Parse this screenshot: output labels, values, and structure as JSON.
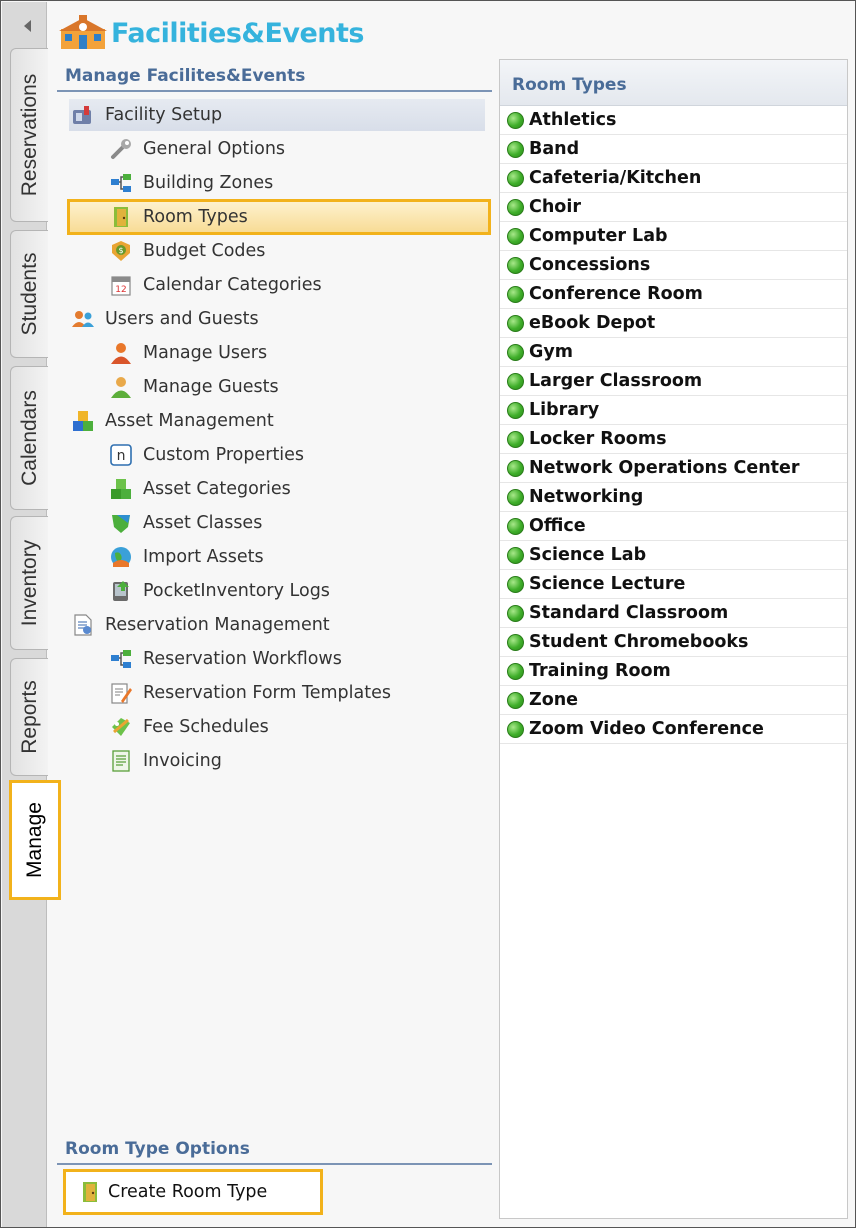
{
  "app": {
    "logo_text": "Facilities&Events"
  },
  "colors": {
    "accent_highlight": "#f2b21b",
    "header_text": "#4a6c98",
    "logo_blue": "#35b3dd",
    "status_green": "#3fae2a"
  },
  "tabs": [
    {
      "label": "Reservations",
      "active": false
    },
    {
      "label": "Students",
      "active": false
    },
    {
      "label": "Calendars",
      "active": false
    },
    {
      "label": "Inventory",
      "active": false
    },
    {
      "label": "Reports",
      "active": false
    },
    {
      "label": "Manage",
      "active": true
    }
  ],
  "manage": {
    "header": "Manage Facilites&Events",
    "items": [
      {
        "label": "Facility Setup",
        "icon": "facility-setup-icon",
        "level": "root",
        "selected": true
      },
      {
        "label": "General Options",
        "icon": "wrench-icon",
        "level": "child"
      },
      {
        "label": "Building Zones",
        "icon": "zones-icon",
        "level": "child"
      },
      {
        "label": "Room Types",
        "icon": "door-icon",
        "level": "child",
        "selected": true
      },
      {
        "label": "Budget Codes",
        "icon": "budget-icon",
        "level": "child"
      },
      {
        "label": "Calendar Categories",
        "icon": "calendar-icon",
        "level": "child"
      },
      {
        "label": "Users and Guests",
        "icon": "users-icon",
        "level": "root"
      },
      {
        "label": "Manage Users",
        "icon": "user-orange-icon",
        "level": "child"
      },
      {
        "label": "Manage Guests",
        "icon": "user-green-icon",
        "level": "child"
      },
      {
        "label": "Asset Management",
        "icon": "blocks-icon",
        "level": "root"
      },
      {
        "label": "Custom Properties",
        "icon": "n-box-icon",
        "level": "child"
      },
      {
        "label": "Asset Categories",
        "icon": "green-blocks-icon",
        "level": "child"
      },
      {
        "label": "Asset Classes",
        "icon": "shield-icon",
        "level": "child"
      },
      {
        "label": "Import Assets",
        "icon": "globe-icon",
        "level": "child"
      },
      {
        "label": "PocketInventory Logs",
        "icon": "device-icon",
        "level": "child"
      },
      {
        "label": "Reservation Management",
        "icon": "document-icon",
        "level": "root"
      },
      {
        "label": "Reservation Workflows",
        "icon": "zones-icon",
        "level": "child"
      },
      {
        "label": "Reservation Form Templates",
        "icon": "form-edit-icon",
        "level": "child"
      },
      {
        "label": "Fee Schedules",
        "icon": "fee-icon",
        "level": "child"
      },
      {
        "label": "Invoicing",
        "icon": "invoice-icon",
        "level": "child"
      }
    ]
  },
  "room_types": {
    "header": "Room Types",
    "items": [
      "Athletics",
      "Band",
      "Cafeteria/Kitchen",
      "Choir",
      "Computer Lab",
      "Concessions",
      "Conference Room",
      "eBook Depot",
      "Gym",
      "Larger Classroom",
      "Library",
      "Locker Rooms",
      "Network Operations Center",
      "Networking",
      "Office",
      "Science Lab",
      "Science Lecture",
      "Standard Classroom",
      "Student Chromebooks",
      "Training Room",
      "Zone",
      "Zoom Video Conference"
    ]
  },
  "options": {
    "header": "Room Type Options",
    "create_label": "Create Room Type"
  }
}
